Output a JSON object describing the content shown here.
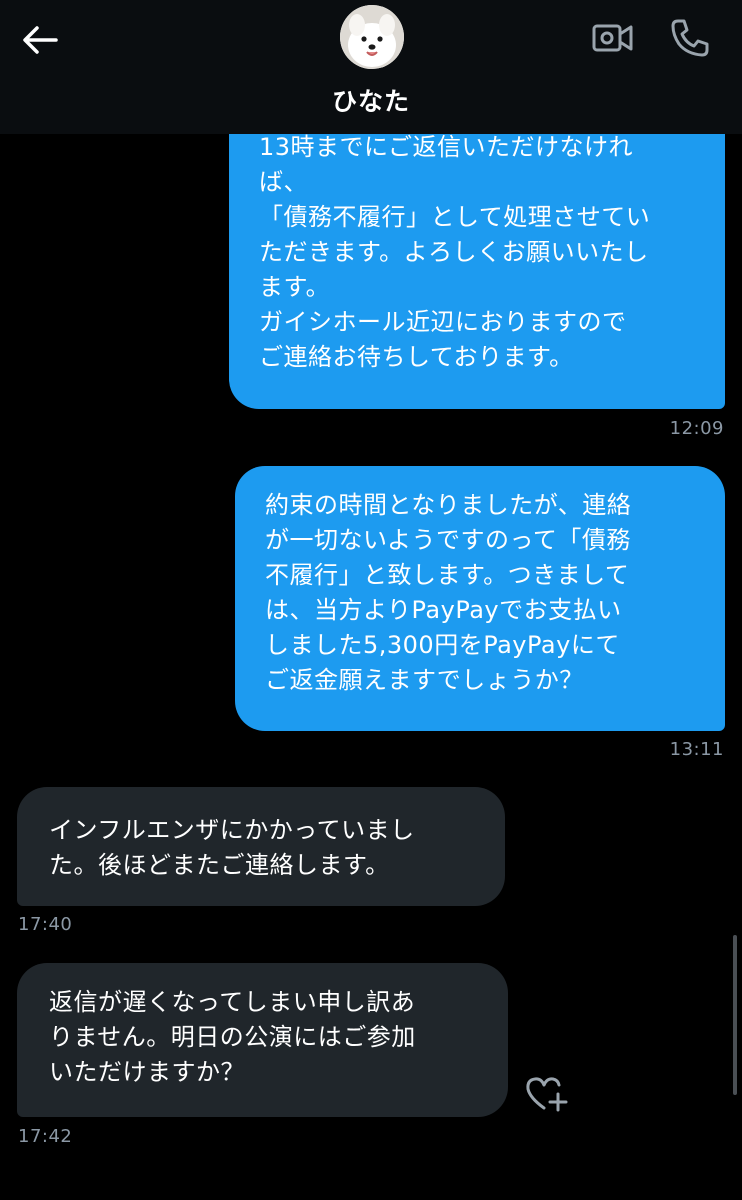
{
  "header": {
    "contact_name": "ひなた",
    "back_icon": "arrow-left-icon",
    "video_icon": "video-camera-icon",
    "call_icon": "phone-icon"
  },
  "messages": [
    {
      "side": "sent",
      "lines": [
        "13時までにご返信いただけなけれ",
        "ば、",
        "「債務不履行」として処理させてい",
        "ただきます。よろしくお願いいたし",
        "ます。",
        "ガイシホール近辺におりますので",
        "ご連絡お待ちしております。"
      ],
      "time": "12:09"
    },
    {
      "side": "sent",
      "lines": [
        "約束の時間となりましたが、連絡",
        "が一切ないようですのって「債務",
        "不履行」と致します。つきまして",
        "は、当方よりPayPayでお支払い",
        "しました5,300円をPayPayにて",
        "ご返金願えますでしょうか？"
      ],
      "time": "13:11"
    },
    {
      "side": "received",
      "lines": [
        "インフルエンザにかかっていまし",
        "た。後ほどまたご連絡します。"
      ],
      "time": "17:40"
    },
    {
      "side": "received",
      "lines": [
        "返信が遅くなってしまい申し訳あ",
        "りません。明日の公演にはご参加",
        "いただけますか？"
      ],
      "time": "17:42"
    }
  ],
  "reaction": {
    "icon": "add-reaction-heart-icon"
  },
  "colors": {
    "background": "#000000",
    "header": "#0a0d10",
    "sent_bubble": "#1d9bf0",
    "received_bubble": "#20262b",
    "timestamp": "#8b98a5"
  }
}
